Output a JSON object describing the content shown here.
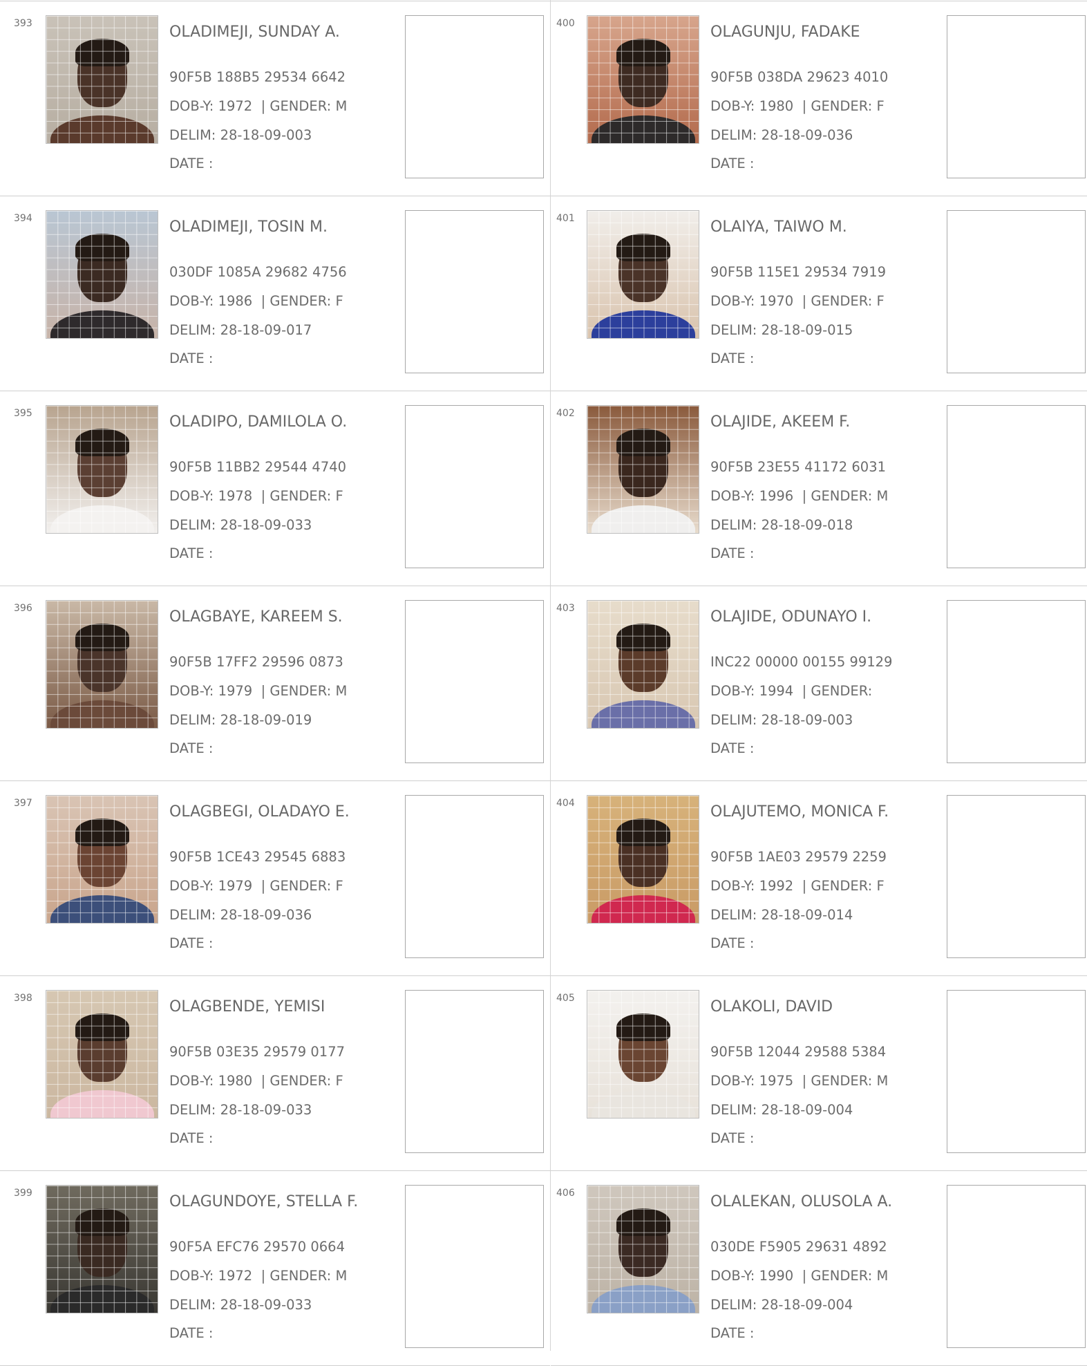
{
  "entries_left": [
    {
      "num": "393",
      "name": "OLADIMEJI, SUNDAY A.",
      "vin": "90F5B 188B5 29534 6642",
      "dob_label": "DOB-Y:",
      "dob": "1972",
      "gender_label": "| GENDER:",
      "gender": "M",
      "delim_label": "DELIM:",
      "delim": "28-18-09-003",
      "date_label": "DATE :",
      "photo": {
        "bg1": "#c9c2b8",
        "bg2": "#b7aea2",
        "skin": "#4a3328",
        "shirt": "#5a3a2c"
      }
    },
    {
      "num": "394",
      "name": "OLADIMEJI, TOSIN M.",
      "vin": "030DF 1085A 29682 4756",
      "dob_label": "DOB-Y:",
      "dob": "1986",
      "gender_label": "| GENDER:",
      "gender": "F",
      "delim_label": "DELIM:",
      "delim": "28-18-09-017",
      "date_label": "DATE :",
      "photo": {
        "bg1": "#b9c6d3",
        "bg2": "#c7b3a8",
        "skin": "#3b2a22",
        "shirt": "#2e2a2c"
      }
    },
    {
      "num": "395",
      "name": "OLADIPO, DAMILOLA O.",
      "vin": "90F5B 11BB2 29544 4740",
      "dob_label": "DOB-Y:",
      "dob": "1978",
      "gender_label": "| GENDER:",
      "gender": "F",
      "delim_label": "DELIM:",
      "delim": "28-18-09-033",
      "date_label": "DATE :",
      "photo": {
        "bg1": "#b8a48f",
        "bg2": "#f2f0ee",
        "skin": "#5b3f33",
        "shirt": "#f4f2f0"
      }
    },
    {
      "num": "396",
      "name": "OLAGBAYE, KAREEM S.",
      "vin": "90F5B 17FF2 29596 0873",
      "dob_label": "DOB-Y:",
      "dob": "1979",
      "gender_label": "| GENDER:",
      "gender": "M",
      "delim_label": "DELIM:",
      "delim": "28-18-09-019",
      "date_label": "DATE :",
      "photo": {
        "bg1": "#c9b8a6",
        "bg2": "#7a5a46",
        "skin": "#4a342a",
        "shirt": "#6b4a3a"
      }
    },
    {
      "num": "397",
      "name": "OLAGBEGI, OLADAYO E.",
      "vin": "90F5B 1CE43 29545 6883",
      "dob_label": "DOB-Y:",
      "dob": "1979",
      "gender_label": "| GENDER:",
      "gender": "F",
      "delim_label": "DELIM:",
      "delim": "28-18-09-036",
      "date_label": "DATE :",
      "photo": {
        "bg1": "#d9c4b4",
        "bg2": "#c9a58c",
        "skin": "#6b4433",
        "shirt": "#3c4f7a"
      }
    },
    {
      "num": "398",
      "name": "OLAGBENDE, YEMISI",
      "vin": "90F5B 03E35 29579 0177",
      "dob_label": "DOB-Y:",
      "dob": "1980",
      "gender_label": "| GENDER:",
      "gender": "F",
      "delim_label": "DELIM:",
      "delim": "28-18-09-033",
      "date_label": "DATE :",
      "photo": {
        "bg1": "#d6c7b2",
        "bg2": "#cbb7a0",
        "skin": "#5a3d2f",
        "shirt": "#f0c8d0"
      }
    },
    {
      "num": "399",
      "name": "OLAGUNDOYE, STELLA F.",
      "vin": "90F5A EFC76 29570 0664",
      "dob_label": "DOB-Y:",
      "dob": "1972",
      "gender_label": "| GENDER:",
      "gender": "M",
      "delim_label": "DELIM:",
      "delim": "28-18-09-033",
      "date_label": "DATE :",
      "photo": {
        "bg1": "#6f6a5e",
        "bg2": "#3a3833",
        "skin": "#3a2a22",
        "shirt": "#2a2a2a"
      }
    }
  ],
  "entries_right": [
    {
      "num": "400",
      "name": "OLAGUNJU, FADAKE",
      "vin": "90F5B 038DA 29623 4010",
      "dob_label": "DOB-Y:",
      "dob": "1980",
      "gender_label": "| GENDER:",
      "gender": "F",
      "delim_label": "DELIM:",
      "delim": "28-18-09-036",
      "date_label": "DATE :",
      "photo": {
        "bg1": "#d7a58c",
        "bg2": "#b36b4d",
        "skin": "#3e2b22",
        "shirt": "#2d2a2a"
      }
    },
    {
      "num": "401",
      "name": "OLAIYA, TAIWO M.",
      "vin": "90F5B 115E1 29534 7919",
      "dob_label": "DOB-Y:",
      "dob": "1970",
      "gender_label": "| GENDER:",
      "gender": "F",
      "delim_label": "DELIM:",
      "delim": "28-18-09-015",
      "date_label": "DATE :",
      "photo": {
        "bg1": "#f1eeea",
        "bg2": "#d9c3ad",
        "skin": "#4a3328",
        "shirt": "#2c3f9c"
      }
    },
    {
      "num": "402",
      "name": "OLAJIDE, AKEEM F.",
      "vin": "90F5B 23E55 41172 6031",
      "dob_label": "DOB-Y:",
      "dob": "1996",
      "gender_label": "| GENDER:",
      "gender": "M",
      "delim_label": "DELIM:",
      "delim": "28-18-09-018",
      "date_label": "DATE :",
      "photo": {
        "bg1": "#8a5a3c",
        "bg2": "#e8dccd",
        "skin": "#3a271e",
        "shirt": "#f0efee"
      }
    },
    {
      "num": "403",
      "name": "OLAJIDE, ODUNAYO I.",
      "vin": "INC22 00000 00155 99129",
      "dob_label": "DOB-Y:",
      "dob": "1994",
      "gender_label": "| GENDER:",
      "gender": "",
      "delim_label": "DELIM:",
      "delim": "28-18-09-003",
      "date_label": "DATE :",
      "photo": {
        "bg1": "#e7dccb",
        "bg2": "#d8c7b2",
        "skin": "#5b3b2a",
        "shirt": "#6a6fa8"
      }
    },
    {
      "num": "404",
      "name": "OLAJUTEMO, MONICA F.",
      "vin": "90F5B 1AE03 29579 2259",
      "dob_label": "DOB-Y:",
      "dob": "1992",
      "gender_label": "| GENDER:",
      "gender": "F",
      "delim_label": "DELIM:",
      "delim": "28-18-09-014",
      "date_label": "DATE :",
      "photo": {
        "bg1": "#d7b27a",
        "bg2": "#c99b66",
        "skin": "#4a3024",
        "shirt": "#d0284f"
      }
    },
    {
      "num": "405",
      "name": "OLAKOLI, DAVID",
      "vin": "90F5B 12044 29588 5384",
      "dob_label": "DOB-Y:",
      "dob": "1975",
      "gender_label": "| GENDER:",
      "gender": "M",
      "delim_label": "DELIM:",
      "delim": "28-18-09-004",
      "date_label": "DATE :",
      "photo": {
        "bg1": "#f3f1ee",
        "bg2": "#e8e2da",
        "skin": "#6a4532",
        "shirt": "#e9e5df"
      }
    },
    {
      "num": "406",
      "name": "OLALEKAN, OLUSOLA A.",
      "vin": "030DE F5905 29631 4892",
      "dob_label": "DOB-Y:",
      "dob": "1990",
      "gender_label": "| GENDER:",
      "gender": "M",
      "delim_label": "DELIM:",
      "delim": "28-18-09-004",
      "date_label": "DATE :",
      "photo": {
        "bg1": "#cfc7bd",
        "bg2": "#bdb3a6",
        "skin": "#3b2a23",
        "shirt": "#8aa0c6"
      }
    }
  ]
}
